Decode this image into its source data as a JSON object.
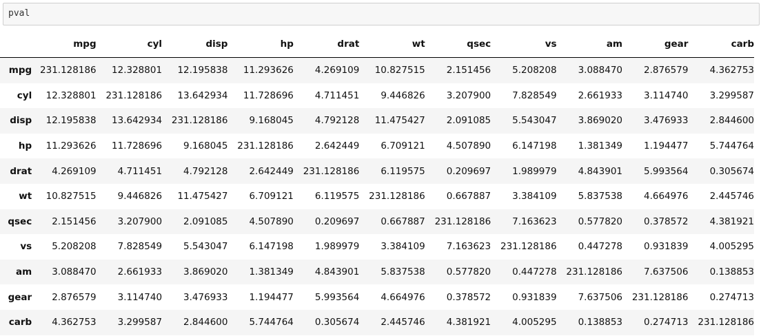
{
  "code_cell": {
    "text": "pval"
  },
  "table": {
    "columns": [
      "mpg",
      "cyl",
      "disp",
      "hp",
      "drat",
      "wt",
      "qsec",
      "vs",
      "am",
      "gear",
      "carb"
    ],
    "rows": [
      {
        "label": "mpg",
        "cells": [
          "231.128186",
          "12.328801",
          "12.195838",
          "11.293626",
          "4.269109",
          "10.827515",
          "2.151456",
          "5.208208",
          "3.088470",
          "2.876579",
          "4.362753"
        ]
      },
      {
        "label": "cyl",
        "cells": [
          "12.328801",
          "231.128186",
          "13.642934",
          "11.728696",
          "4.711451",
          "9.446826",
          "3.207900",
          "7.828549",
          "2.661933",
          "3.114740",
          "3.299587"
        ]
      },
      {
        "label": "disp",
        "cells": [
          "12.195838",
          "13.642934",
          "231.128186",
          "9.168045",
          "4.792128",
          "11.475427",
          "2.091085",
          "5.543047",
          "3.869020",
          "3.476933",
          "2.844600"
        ]
      },
      {
        "label": "hp",
        "cells": [
          "11.293626",
          "11.728696",
          "9.168045",
          "231.128186",
          "2.642449",
          "6.709121",
          "4.507890",
          "6.147198",
          "1.381349",
          "1.194477",
          "5.744764"
        ]
      },
      {
        "label": "drat",
        "cells": [
          "4.269109",
          "4.711451",
          "4.792128",
          "2.642449",
          "231.128186",
          "6.119575",
          "0.209697",
          "1.989979",
          "4.843901",
          "5.993564",
          "0.305674"
        ]
      },
      {
        "label": "wt",
        "cells": [
          "10.827515",
          "9.446826",
          "11.475427",
          "6.709121",
          "6.119575",
          "231.128186",
          "0.667887",
          "3.384109",
          "5.837538",
          "4.664976",
          "2.445746"
        ]
      },
      {
        "label": "qsec",
        "cells": [
          "2.151456",
          "3.207900",
          "2.091085",
          "4.507890",
          "0.209697",
          "0.667887",
          "231.128186",
          "7.163623",
          "0.577820",
          "0.378572",
          "4.381921"
        ]
      },
      {
        "label": "vs",
        "cells": [
          "5.208208",
          "7.828549",
          "5.543047",
          "6.147198",
          "1.989979",
          "3.384109",
          "7.163623",
          "231.128186",
          "0.447278",
          "0.931839",
          "4.005295"
        ]
      },
      {
        "label": "am",
        "cells": [
          "3.088470",
          "2.661933",
          "3.869020",
          "1.381349",
          "4.843901",
          "5.837538",
          "0.577820",
          "0.447278",
          "231.128186",
          "7.637506",
          "0.138853"
        ]
      },
      {
        "label": "gear",
        "cells": [
          "2.876579",
          "3.114740",
          "3.476933",
          "1.194477",
          "5.993564",
          "4.664976",
          "0.378572",
          "0.931839",
          "7.637506",
          "231.128186",
          "0.274713"
        ]
      },
      {
        "label": "carb",
        "cells": [
          "4.362753",
          "3.299587",
          "2.844600",
          "5.744764",
          "0.305674",
          "2.445746",
          "4.381921",
          "4.005295",
          "0.138853",
          "0.274713",
          "231.128186"
        ]
      }
    ]
  }
}
